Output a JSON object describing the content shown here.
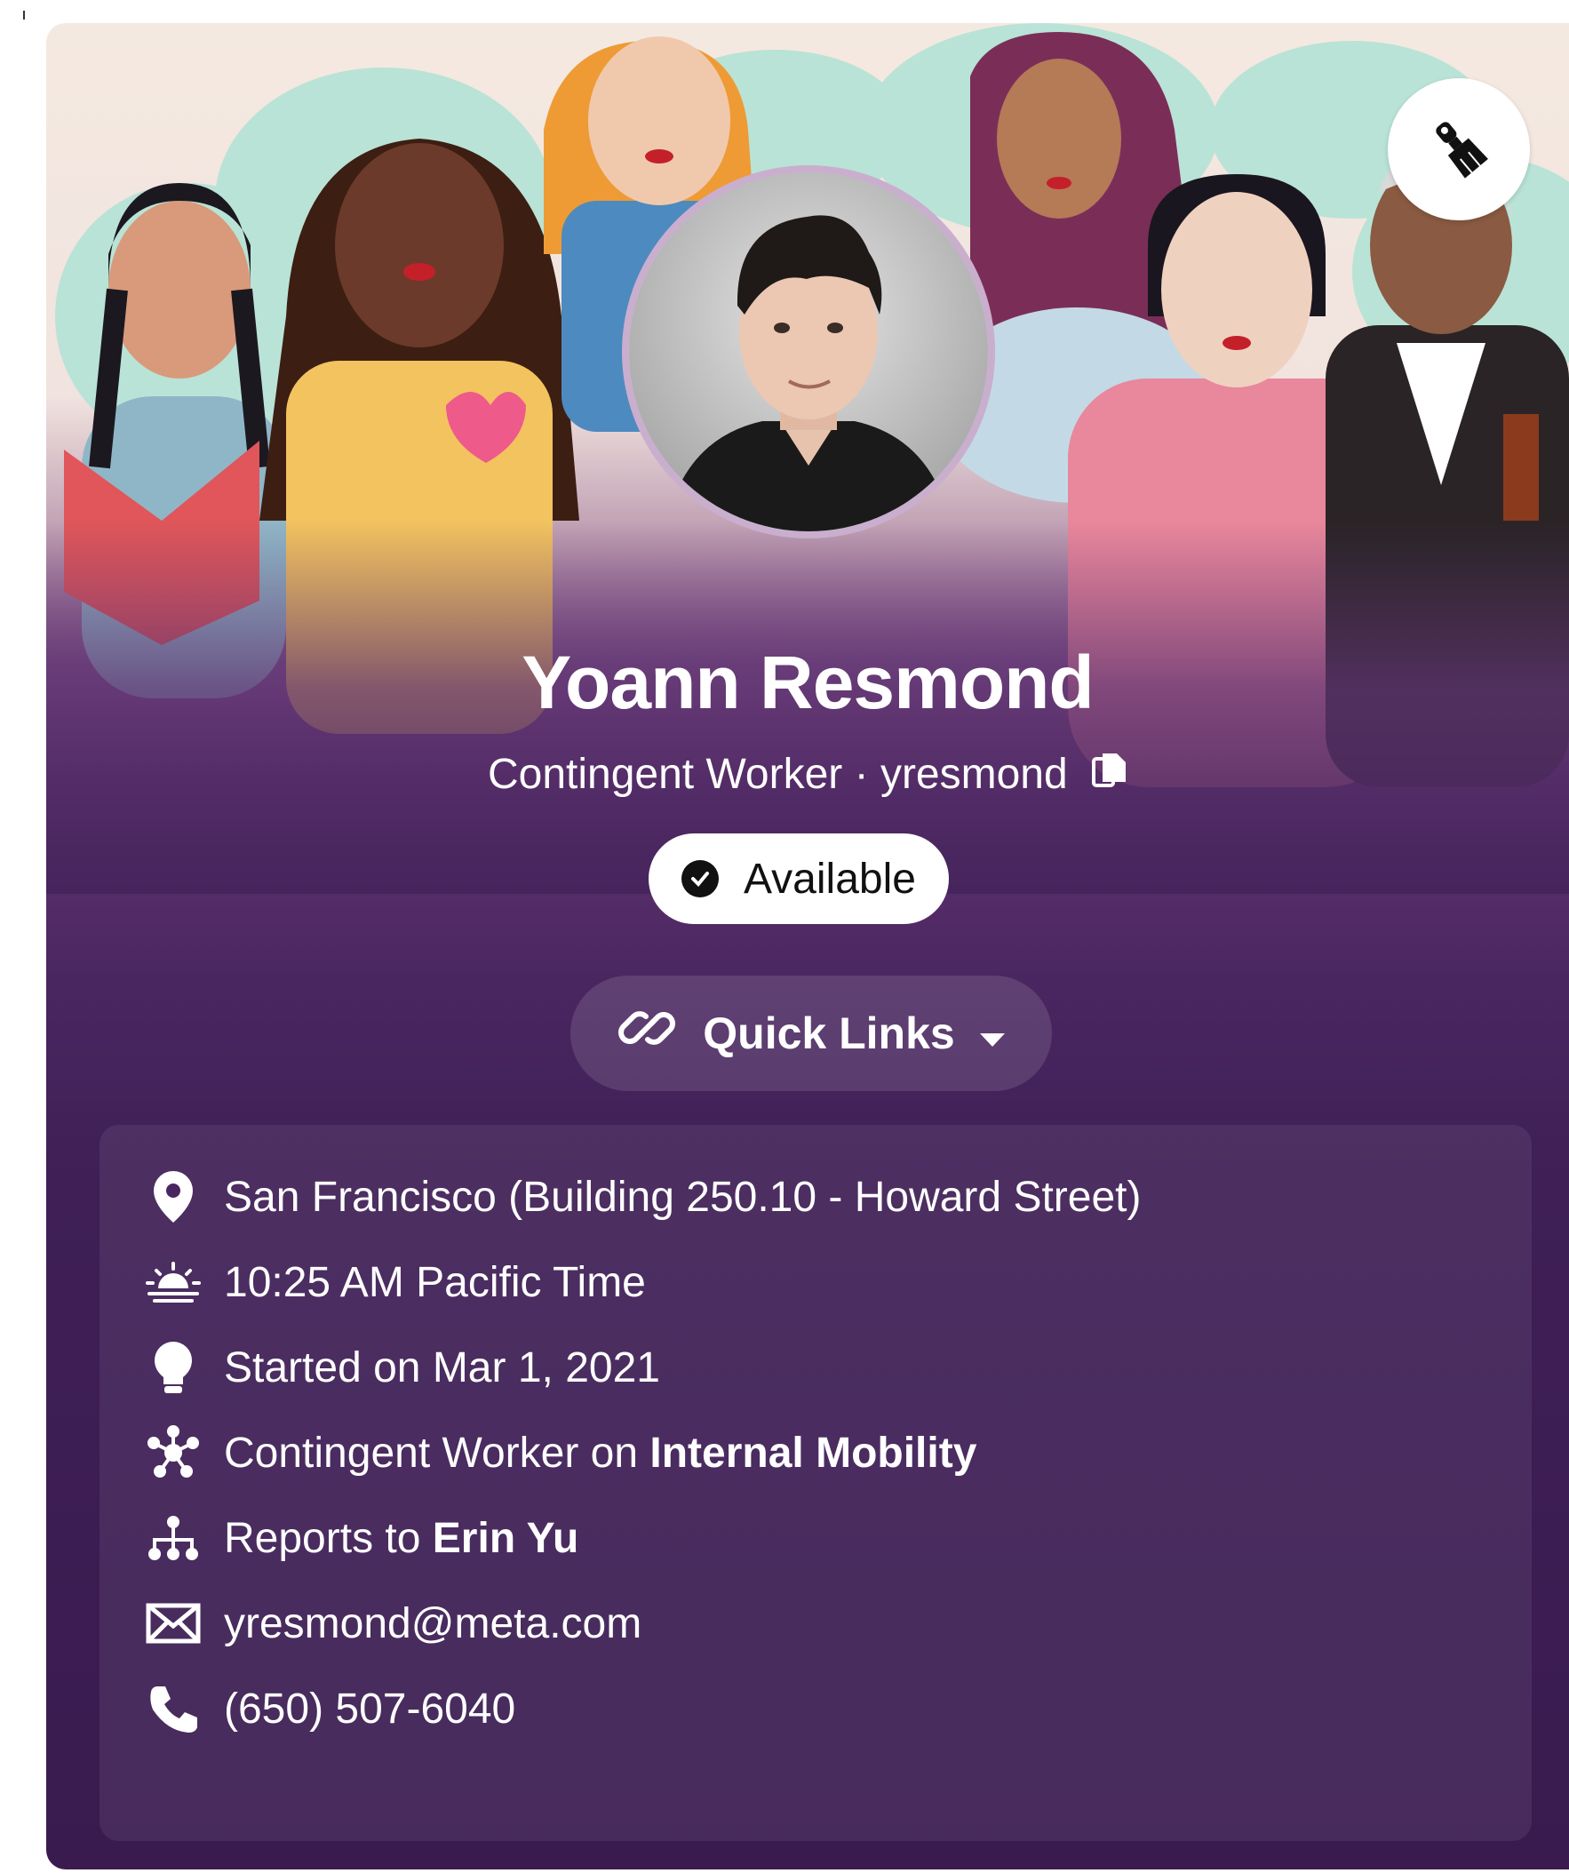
{
  "profile": {
    "name": "Yoann Resmond",
    "role": "Contingent Worker",
    "separator": "·",
    "username": "yresmond",
    "status": "Available",
    "quick_links_label": "Quick Links"
  },
  "details": {
    "location": "San Francisco (Building 250.10 - Howard Street)",
    "local_time": "10:25 AM Pacific Time",
    "start_date": "Started on Mar 1, 2021",
    "team_prefix": "Contingent Worker on ",
    "team_name": "Internal Mobility",
    "reports_prefix": "Reports to ",
    "manager": "Erin Yu",
    "email": "yresmond@meta.com",
    "phone": "(650) 507-6040"
  },
  "icons": {
    "customize": "paintbrush-icon",
    "copy": "copy-icon",
    "status": "check-circle-icon",
    "quick_links": "link-icon",
    "dropdown": "caret-down-icon",
    "location": "map-pin-icon",
    "time": "sunrise-icon",
    "start": "lightbulb-icon",
    "team": "team-icon",
    "reports": "org-chart-icon",
    "email": "envelope-icon",
    "phone": "phone-icon"
  },
  "colors": {
    "card_top": "#f4e9e0",
    "card_purple": "#5e3370",
    "card_dark": "#3a1b50",
    "text": "#ffffff"
  }
}
